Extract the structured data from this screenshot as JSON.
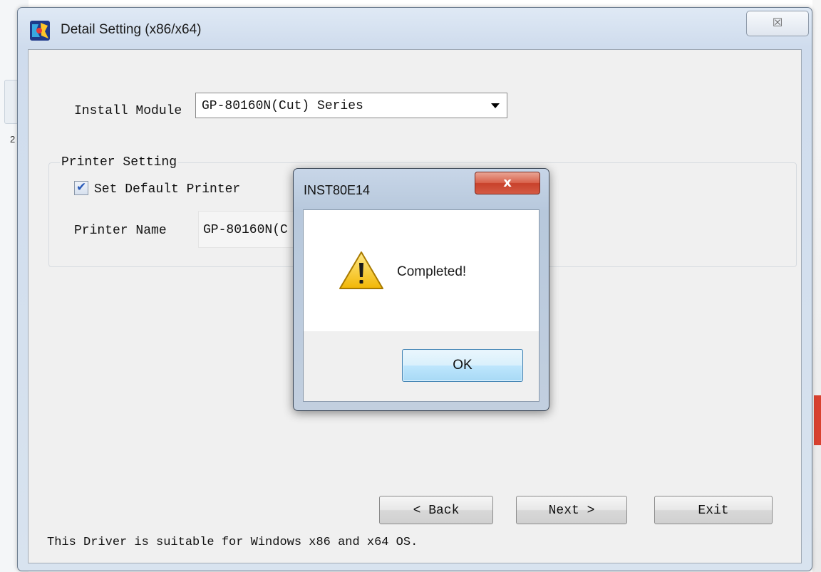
{
  "background": {
    "left_number": "2"
  },
  "main_window": {
    "title": "Detail Setting (x86/x64)",
    "close_glyph": "☒",
    "install_module": {
      "label": "Install Module",
      "value": "GP-80160N(Cut) Series"
    },
    "printer_setting": {
      "legend": "Printer Setting",
      "set_default": {
        "label": "Set Default Printer",
        "checked": true,
        "check_glyph": "✔"
      },
      "printer_name": {
        "label": "Printer Name",
        "value": "GP-80160N(C"
      }
    },
    "buttons": {
      "back": "< Back",
      "next": "Next >",
      "exit": "Exit"
    },
    "footer": "This Driver is suitable for Windows x86 and x64 OS."
  },
  "message_box": {
    "title": "INST80E14",
    "close_glyph": "x",
    "icon": "warning-icon",
    "message": "Completed!",
    "ok_label": "OK"
  },
  "colors": {
    "accent_close": "#c8412b",
    "ok_button": "#bee6fd",
    "checkbox_mark": "#2859b8"
  }
}
